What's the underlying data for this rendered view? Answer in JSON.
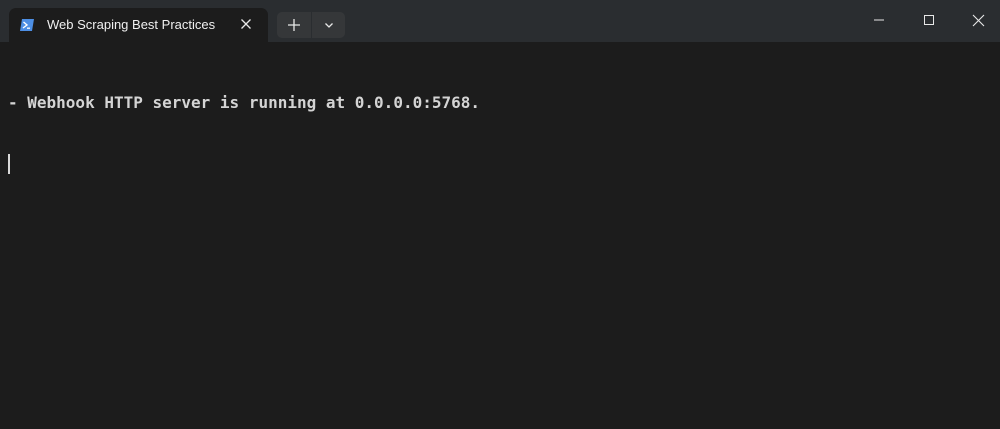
{
  "window": {
    "tab": {
      "title": "Web Scraping Best Practices",
      "icon": "powershell-icon"
    },
    "controls": {
      "new_tab_icon": "plus-icon",
      "dropdown_icon": "chevron-down-icon",
      "minimize_icon": "minimize-icon",
      "maximize_icon": "maximize-icon",
      "close_icon": "close-icon"
    },
    "colors": {
      "titlebar": "#2a2d30",
      "terminal_background": "#1c1c1c",
      "tab_icon_accent": "#4d8fe5"
    }
  },
  "terminal": {
    "lines": [
      "- Webhook HTTP server is running at 0.0.0.0:5768."
    ]
  }
}
